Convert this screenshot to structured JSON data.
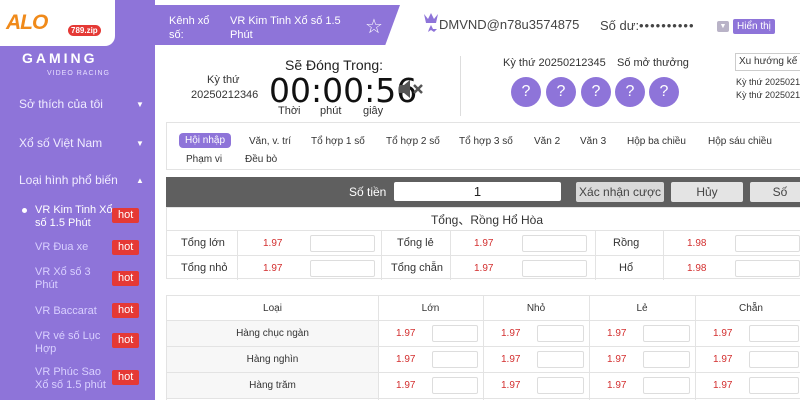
{
  "logo": {
    "text": "ALO",
    "badge": "789.zip",
    "brand": "GAMING",
    "brand_sub": "VIDEO RACING"
  },
  "sidebar": {
    "items": [
      {
        "label": "Sở thích của tôi"
      },
      {
        "label": "Xổ số Việt Nam"
      },
      {
        "label": "Loại hình phổ biến"
      }
    ],
    "games": [
      {
        "label": "VR Kim Tinh Xổ số 1.5 Phút",
        "badge": "hot"
      },
      {
        "label": "VR Đua xe",
        "badge": "hot"
      },
      {
        "label": "VR Xổ số 3 Phút",
        "badge": "hot"
      },
      {
        "label": "VR Baccarat",
        "badge": "hot"
      },
      {
        "label": "VR vé số Lục Hợp",
        "badge": "hot"
      },
      {
        "label": "VR Phúc Sao Xổ số 1.5 phút",
        "badge": "hot"
      }
    ]
  },
  "header": {
    "channel_label": "Kênh xổ số:",
    "channel_name": "VR Kim Tinh Xổ số 1.5 Phút",
    "username": "DMVND@n78u3574875",
    "balance_label": "Số dư:",
    "balance_value": "••••••••••",
    "show_label": "Hiển thị"
  },
  "draw": {
    "period_label": "Kỳ thứ",
    "period_value": "20250212346",
    "close_label": "Sẽ Đóng Trong:",
    "timer": "00:00:56",
    "units": [
      "Thời",
      "phút",
      "giây"
    ],
    "last_period": "Kỳ thứ 20250212345",
    "result_label": "Số mở thưởng",
    "balls": [
      "?",
      "?",
      "?",
      "?",
      "?"
    ],
    "trend_select": "Xu hướng kế",
    "trend_rows": [
      "Kỳ thứ 2025021",
      "Kỳ thứ 2025021"
    ]
  },
  "tabs": [
    "Hội nhập",
    "Văn, v. trí",
    "Tổ hợp 1 số",
    "Tổ hợp 2 số",
    "Tổ hợp 3 số",
    "Văn 2",
    "Văn 3",
    "Hộp ba chiều",
    "Hộp sáu chiều",
    "Phạm vi",
    "Đều bò"
  ],
  "amount": {
    "label": "Số tiền",
    "value": "1",
    "confirm": "Xác nhận cược",
    "cancel": "Hủy",
    "extra": "Số"
  },
  "tong_rong": {
    "title": "Tổng、Rồng Hổ Hòa",
    "rows": [
      [
        {
          "label": "Tổng lớn",
          "odd": "1.97"
        },
        {
          "label": "Tổng lẻ",
          "odd": "1.97"
        },
        {
          "label": "Rồng",
          "odd": "1.98"
        }
      ],
      [
        {
          "label": "Tổng nhỏ",
          "odd": "1.97"
        },
        {
          "label": "Tổng chẵn",
          "odd": "1.97"
        },
        {
          "label": "Hổ",
          "odd": "1.98"
        }
      ]
    ]
  },
  "positions": {
    "header": "Loại",
    "columns": [
      "Lớn",
      "Nhỏ",
      "Lẻ",
      "Chẵn"
    ],
    "rows": [
      {
        "label": "Hàng chục ngàn",
        "odds": [
          "1.97",
          "1.97",
          "1.97",
          "1.97"
        ]
      },
      {
        "label": "Hàng nghìn",
        "odds": [
          "1.97",
          "1.97",
          "1.97",
          "1.97"
        ]
      },
      {
        "label": "Hàng trăm",
        "odds": [
          "1.97",
          "1.97",
          "1.97",
          "1.97"
        ]
      }
    ]
  }
}
